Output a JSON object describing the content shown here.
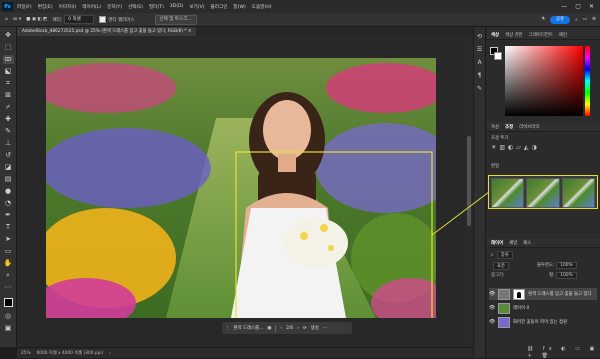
{
  "menubar": {
    "logo": "Ps",
    "items": [
      "파일(F)",
      "편집(E)",
      "이미지(I)",
      "레이어(L)",
      "문자(Y)",
      "선택(S)",
      "필터(T)",
      "3D(D)",
      "보기(V)",
      "플러그인",
      "창(W)",
      "도움말(H)"
    ],
    "window_controls": [
      "—",
      "▢",
      "✕"
    ]
  },
  "optbar": {
    "feather_label": "페더:",
    "feather_value": "0 픽셀",
    "antialias_label": "앤티 앨리어스",
    "select_mask_label": "선택 및 마스크...",
    "share_label": "공유"
  },
  "doc": {
    "tab_title": "AdobeStock_486273525.psd @ 25% (흰색 드레스를 입고 꽃을 들고 있다, RGB/8) *"
  },
  "ctxbar": {
    "title": "흰색 드레스를...",
    "page": "2/6",
    "generate": "생성"
  },
  "status": {
    "zoom": "25%",
    "info": "6000 픽셀 x 4000 픽셀 (300 ppi)"
  },
  "color_panel": {
    "tabs": [
      "색상",
      "색상 견본",
      "그레이디언트",
      "패턴"
    ],
    "foreground": "#000000",
    "background": "#ffffff"
  },
  "adjust_panel": {
    "tabs": [
      "속성",
      "조정",
      "라이브러리"
    ],
    "label": "조정 추가"
  },
  "libs_panel": {
    "header": "변형",
    "thumb_count": 3
  },
  "layers_panel": {
    "tabs": [
      "레이어",
      "채널",
      "패스"
    ],
    "search": "종류",
    "blend_mode": "표준",
    "opacity_label": "불투명도:",
    "opacity_value": "100%",
    "lock_label": "잠그기:",
    "fill_label": "칠:",
    "fill_value": "100%",
    "layers": [
      {
        "name": "흰색 드레스를 입고 꽃을 들고 있다",
        "selected": true
      },
      {
        "name": "레이어 0",
        "selected": false
      },
      {
        "name": "화려한 꽃들이 피어 있는 정원",
        "selected": false
      }
    ]
  }
}
